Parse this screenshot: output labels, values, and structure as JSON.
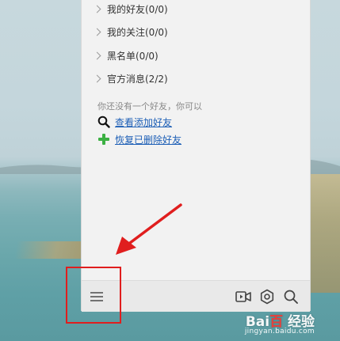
{
  "groups": [
    {
      "label": "我的好友(0/0)"
    },
    {
      "label": "我的关注(0/0)"
    },
    {
      "label": "黑名单(0/0)"
    },
    {
      "label": "官方消息(2/2)"
    }
  ],
  "empty_state": {
    "hint": "你还没有一个好友，你可以",
    "search_link": "查看添加好友",
    "restore_link": "恢复已删除好友"
  },
  "bottom_bar": {
    "icons": [
      "menu-icon",
      "video-icon",
      "settings-icon",
      "search-icon"
    ]
  },
  "watermark": {
    "logo_text": "Bai百 经验",
    "url": "jingyan.baidu.com"
  },
  "colors": {
    "annotation": "#e01e1e",
    "link": "#1d5fb6",
    "add_icon": "#3cb043"
  }
}
